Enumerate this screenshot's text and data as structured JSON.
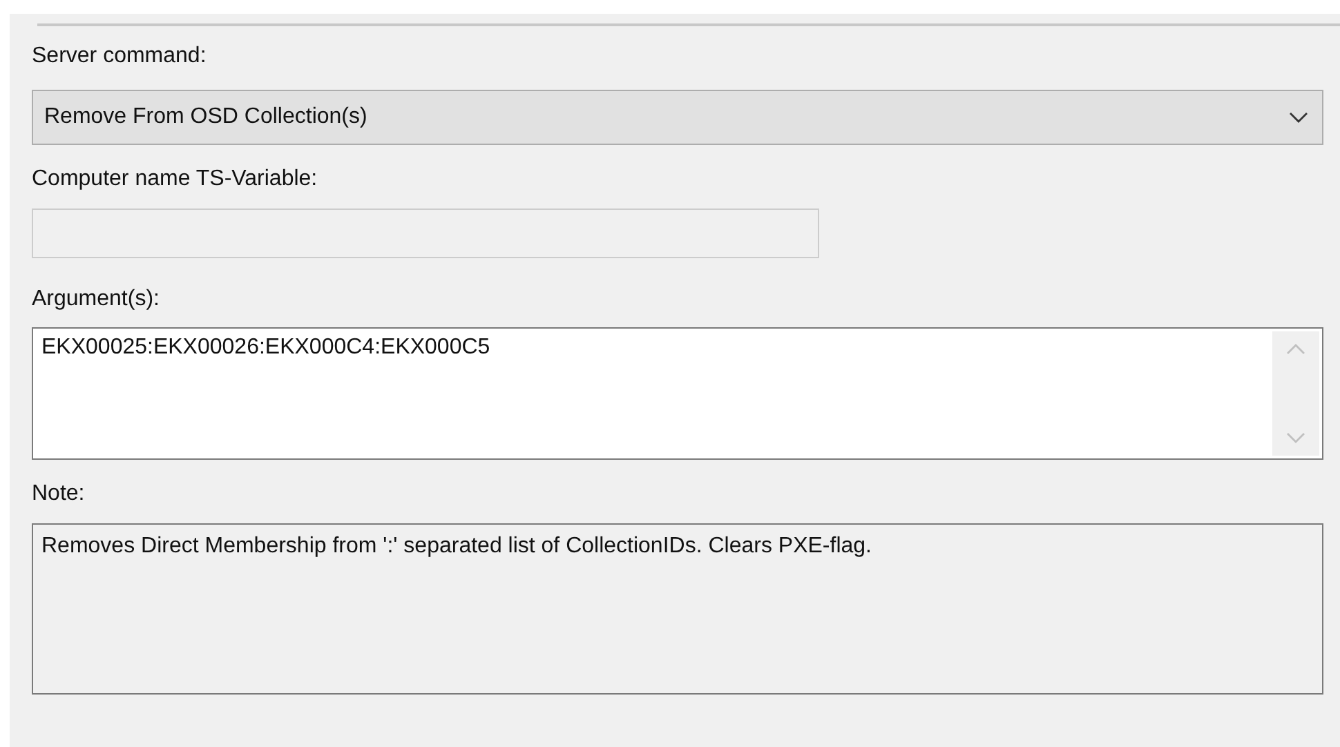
{
  "server_command": {
    "label": "Server command:",
    "value": "Remove From OSD Collection(s)"
  },
  "computer_name": {
    "label": "Computer name TS-Variable:",
    "disabled": true
  },
  "arguments": {
    "label": "Argument(s):",
    "value": "EKX00025:EKX00026:EKX000C4:EKX000C5"
  },
  "note": {
    "label": "Note:",
    "text": "Removes Direct Membership from ':' separated list of CollectionIDs. Clears PXE-flag."
  }
}
